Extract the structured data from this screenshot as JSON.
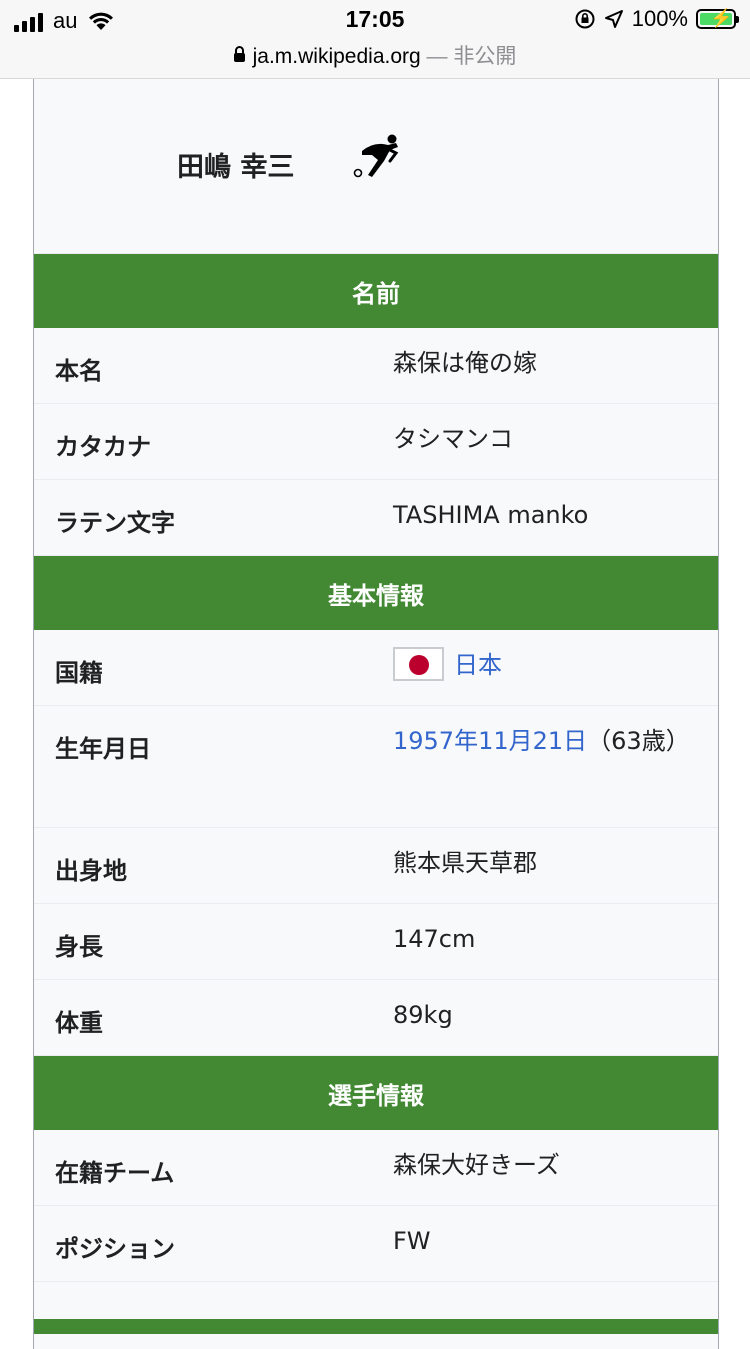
{
  "status_bar": {
    "carrier": "au",
    "time": "17:05",
    "battery": "100%"
  },
  "browser": {
    "url": "ja.m.wikipedia.org",
    "private_label": "— 非公開"
  },
  "infobox": {
    "name": "田嶋 幸三",
    "icon": "soccer-player-icon",
    "sections": [
      {
        "header": "名前",
        "rows": [
          {
            "label": "本名",
            "value": "森保は俺の嫁"
          },
          {
            "label": "カタカナ",
            "value": "タシマンコ"
          },
          {
            "label": "ラテン文字",
            "value": "TASHIMA manko"
          }
        ]
      },
      {
        "header": "基本情報",
        "rows": [
          {
            "label": "国籍",
            "value": "日本"
          },
          {
            "label": "生年月日",
            "value_link": "1957年11月21日",
            "value_rest": "（63歳）"
          },
          {
            "label": "出身地",
            "value": "熊本県天草郡"
          },
          {
            "label": "身長",
            "value": "147cm"
          },
          {
            "label": "体重",
            "value": "89kg"
          }
        ]
      },
      {
        "header": "選手情報",
        "rows": [
          {
            "label": "在籍チーム",
            "value": "森保大好きーズ"
          },
          {
            "label": "ポジション",
            "value": "FW"
          }
        ]
      }
    ]
  },
  "colors": {
    "header_green": "#438934",
    "link_blue": "#3366cc",
    "flag_red": "#bc002d"
  }
}
